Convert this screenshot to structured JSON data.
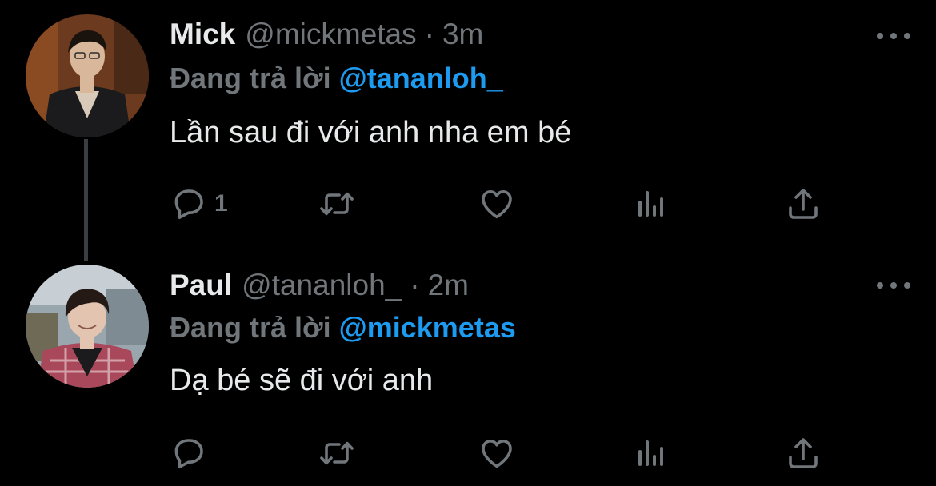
{
  "tweets": [
    {
      "display_name": "Mick",
      "handle": "@mickmetas",
      "separator": "·",
      "time": "3m",
      "reply_prefix": "Đang trả lời",
      "reply_to": "@tananloh_",
      "text": "Lần sau đi với anh nha em bé",
      "reply_count": "1",
      "avatar_colors": {
        "bg": "#6b3a1f",
        "suit": "#1b1b1d",
        "skin": "#d9b79a",
        "hair": "#1a120c"
      }
    },
    {
      "display_name": "Paul",
      "handle": "@tananloh_",
      "separator": "·",
      "time": "2m",
      "reply_prefix": "Đang trả lời",
      "reply_to": "@mickmetas",
      "text": "Dạ bé sẽ đi với anh",
      "reply_count": "",
      "avatar_colors": {
        "bg": "#9aa6ae",
        "shirt": "#a9485a",
        "skin": "#e2c4b0",
        "hair": "#241915"
      }
    }
  ],
  "icons": {
    "more": "more-dots-icon",
    "reply": "reply-icon",
    "retweet": "retweet-icon",
    "like": "heart-icon",
    "views": "views-icon",
    "share": "share-icon"
  },
  "colors": {
    "background": "#000000",
    "primary_text": "#e7e9ea",
    "secondary_text": "#71767b",
    "accent": "#1d9bf0",
    "thread_line": "#3a3d41"
  }
}
